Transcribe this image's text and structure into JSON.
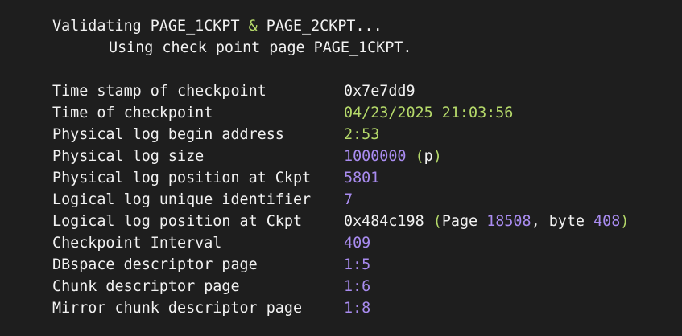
{
  "header": {
    "validating_prefix": "Validating PAGE_1CKPT",
    "ampersand": "&",
    "validating_suffix": "PAGE_2CKPT...",
    "using_line": "Using check point page PAGE_1CKPT."
  },
  "fields": {
    "timestamp": {
      "label": "Time stamp of checkpoint",
      "value": "0x7e7dd9"
    },
    "time": {
      "label": "Time of checkpoint",
      "value": "04/23/2025 21:03:56"
    },
    "phys_begin": {
      "label": "Physical log begin address",
      "value": "2:53"
    },
    "phys_size": {
      "label": "Physical log size",
      "value": "1000000",
      "paren_open": "(",
      "unit": "p",
      "paren_close": ")"
    },
    "phys_pos": {
      "label": "Physical log position at Ckpt",
      "value": "5801"
    },
    "log_uid": {
      "label": "Logical log unique identifier",
      "value": "7"
    },
    "log_pos": {
      "label": "Logical log position at Ckpt",
      "value": "0x484c198",
      "paren_open": "(",
      "page_word": "Page",
      "page_num": "18508",
      "comma_byte": ", byte",
      "byte_num": "408",
      "paren_close": ")"
    },
    "interval": {
      "label": "Checkpoint Interval",
      "value": "409"
    },
    "dbspace": {
      "label": "DBspace descriptor page",
      "value": "1:5"
    },
    "chunk": {
      "label": "Chunk descriptor page",
      "value": "1:6"
    },
    "mirror": {
      "label": "Mirror chunk descriptor page",
      "value": "1:8"
    }
  },
  "colors": {
    "background": "#1e1e1e",
    "text": "#f2f2f2",
    "green": "#b5d96a",
    "purple": "#a98cf0"
  }
}
